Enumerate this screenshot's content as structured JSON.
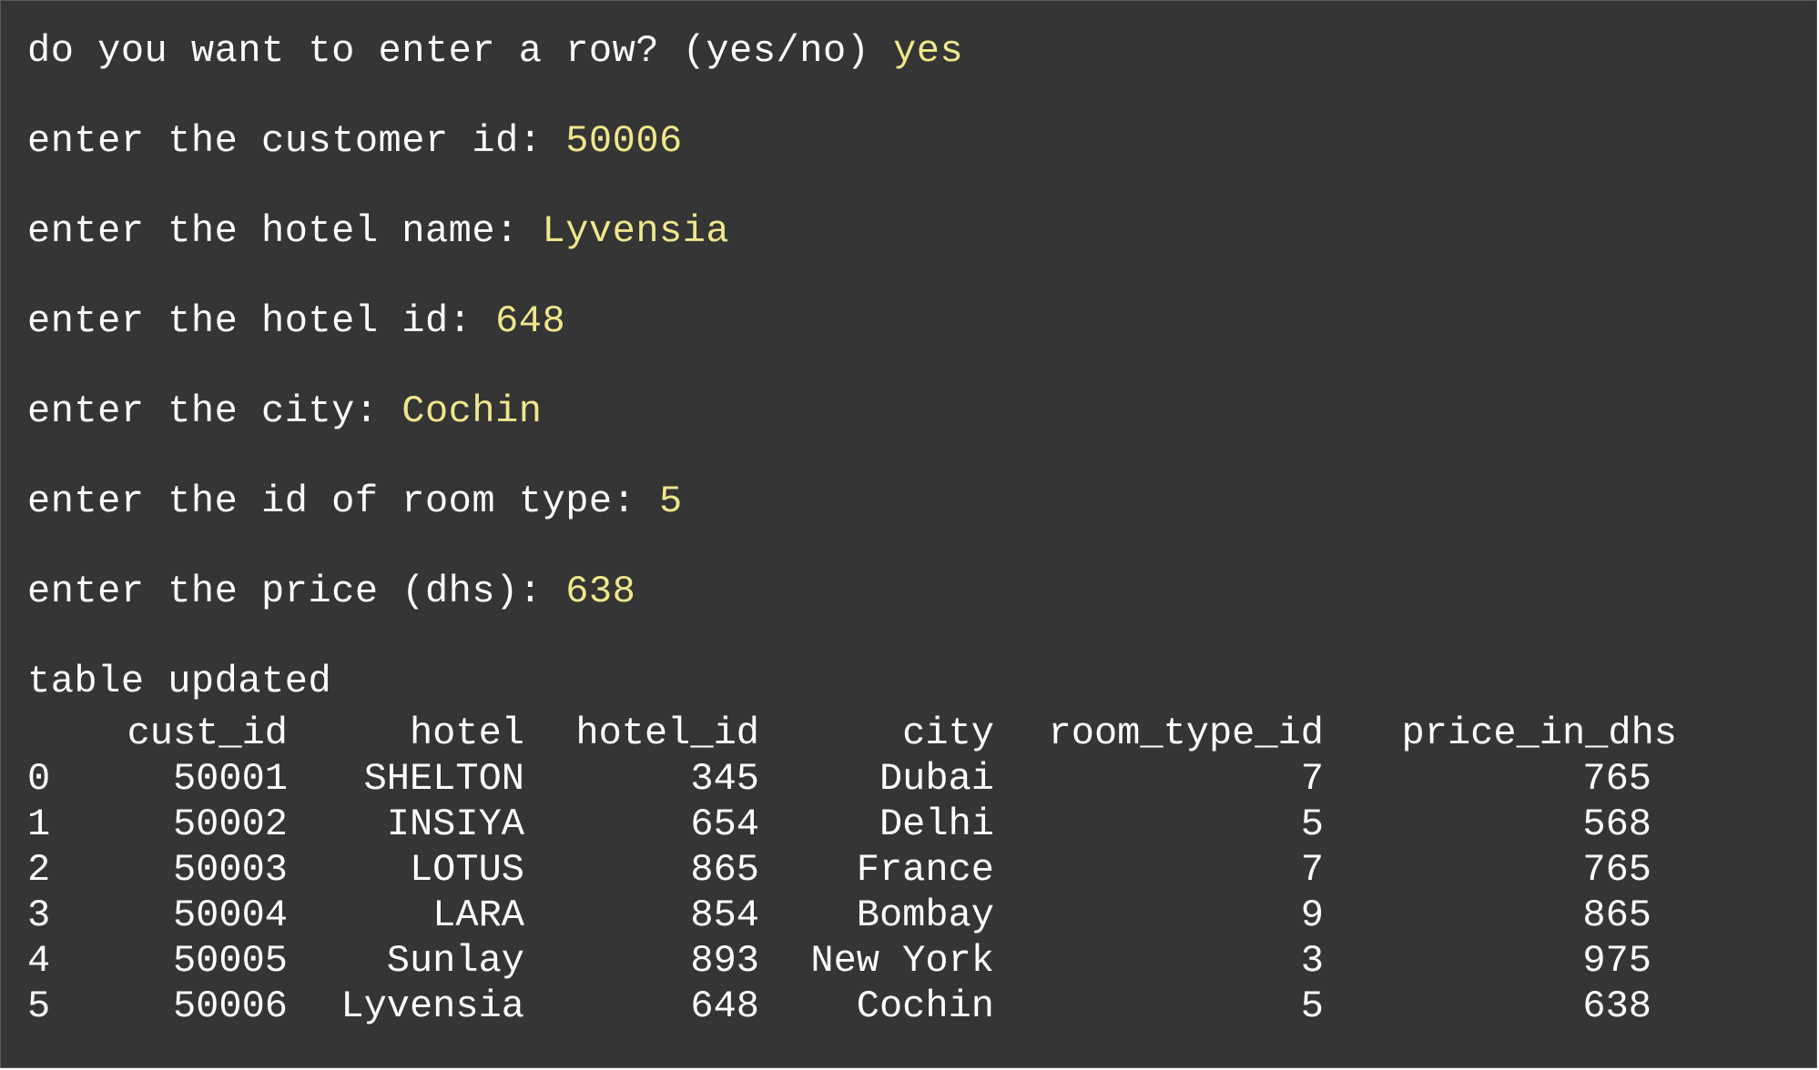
{
  "prompts": [
    {
      "label": "do you want to enter a row? (yes/no) ",
      "answer": "yes"
    },
    {
      "label": "enter the customer id: ",
      "answer": "50006"
    },
    {
      "label": "enter the hotel name: ",
      "answer": "Lyvensia"
    },
    {
      "label": "enter the hotel id: ",
      "answer": "648"
    },
    {
      "label": "enter the city: ",
      "answer": "Cochin"
    },
    {
      "label": "enter the id of room type: ",
      "answer": "5"
    },
    {
      "label": "enter the price (dhs): ",
      "answer": "638"
    }
  ],
  "status": "table updated",
  "table": {
    "columns": [
      "cust_id",
      "hotel",
      "hotel_id",
      "city",
      "room_type_id",
      "price_in_dhs"
    ],
    "rows": [
      {
        "index": "0",
        "cust_id": "50001",
        "hotel": "SHELTON",
        "hotel_id": "345",
        "city": "Dubai",
        "room_type_id": "7",
        "price_in_dhs": "765"
      },
      {
        "index": "1",
        "cust_id": "50002",
        "hotel": "INSIYA",
        "hotel_id": "654",
        "city": "Delhi",
        "room_type_id": "5",
        "price_in_dhs": "568"
      },
      {
        "index": "2",
        "cust_id": "50003",
        "hotel": "LOTUS",
        "hotel_id": "865",
        "city": "France",
        "room_type_id": "7",
        "price_in_dhs": "765"
      },
      {
        "index": "3",
        "cust_id": "50004",
        "hotel": "LARA",
        "hotel_id": "854",
        "city": "Bombay",
        "room_type_id": "9",
        "price_in_dhs": "865"
      },
      {
        "index": "4",
        "cust_id": "50005",
        "hotel": "Sunlay",
        "hotel_id": "893",
        "city": "New York",
        "room_type_id": "3",
        "price_in_dhs": "975"
      },
      {
        "index": "5",
        "cust_id": "50006",
        "hotel": "Lyvensia",
        "hotel_id": "648",
        "city": "Cochin",
        "room_type_id": "5",
        "price_in_dhs": "638"
      }
    ]
  },
  "colors": {
    "background": "#353535",
    "text": "#ffffff",
    "input_text": "#f0e68c"
  }
}
